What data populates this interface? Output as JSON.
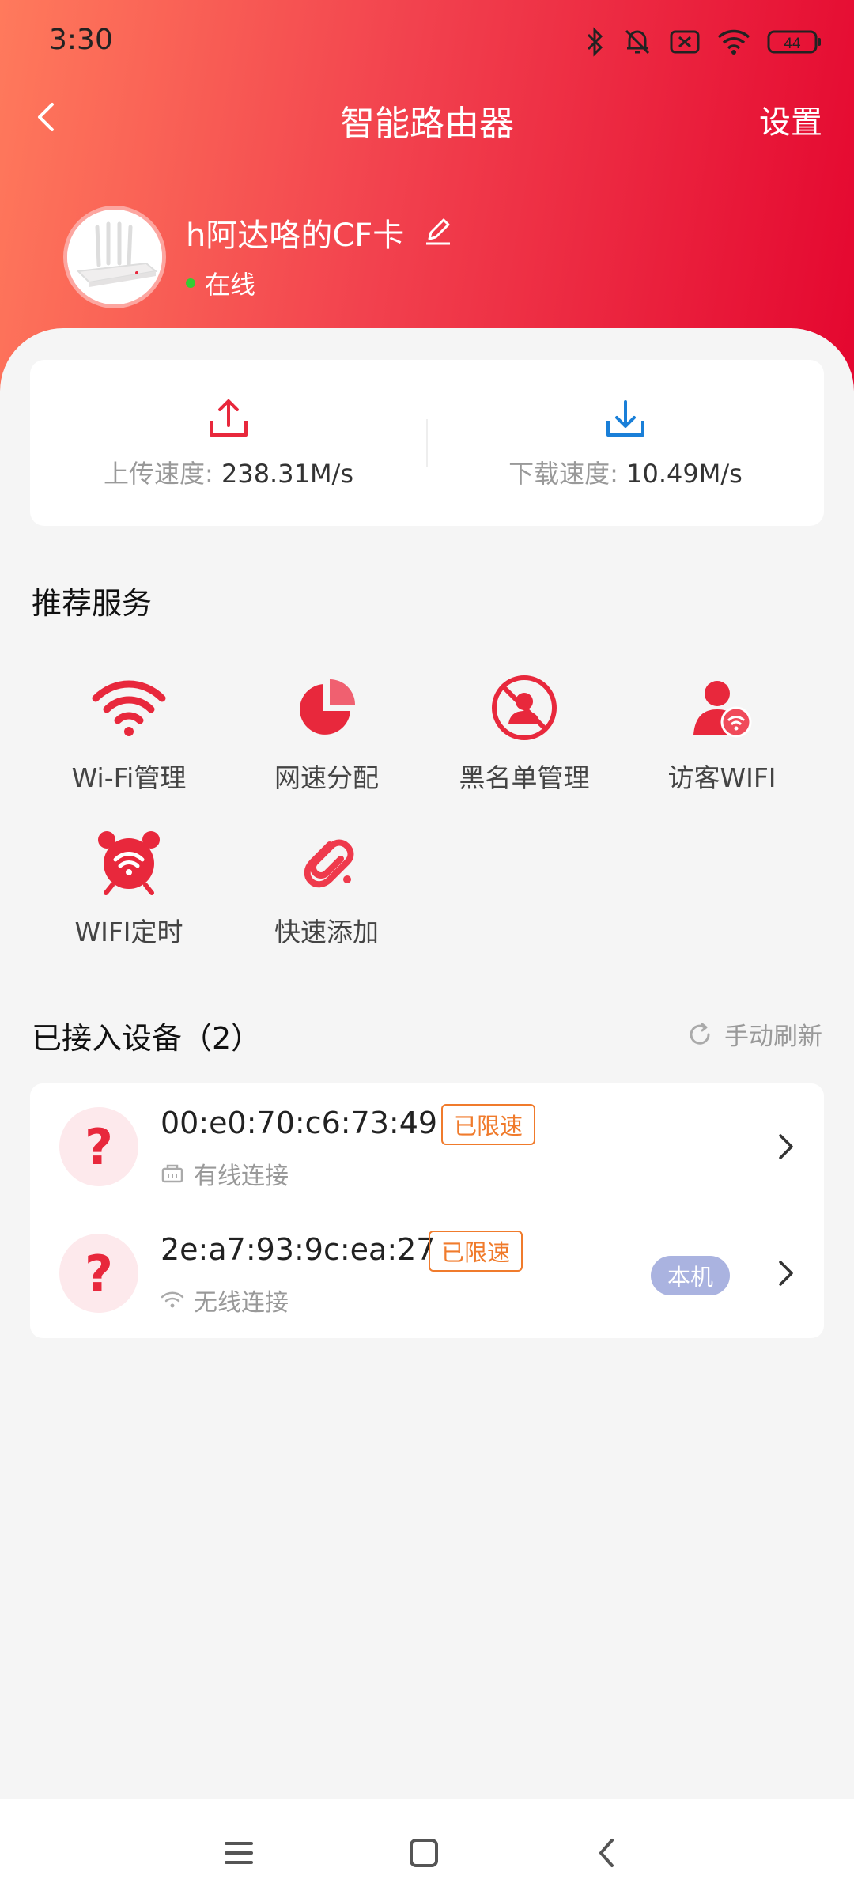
{
  "status_bar": {
    "time": "3:30",
    "battery": "44",
    "icons": [
      "bluetooth-icon",
      "mute-bell-icon",
      "sim-off-icon",
      "wifi-icon",
      "battery-icon"
    ]
  },
  "header": {
    "title": "智能路由器",
    "settings_label": "设置",
    "back_icon": "chevron-left-icon"
  },
  "router": {
    "name": "h阿达咯的CF卡",
    "status": "在线",
    "status_color": "#33cc33"
  },
  "speed": {
    "upload_label": "上传速度:",
    "upload_value": "238.31M/s",
    "download_label": "下载速度:",
    "download_value": "10.49M/s"
  },
  "services": {
    "title": "推荐服务",
    "items": [
      {
        "label": "Wi-Fi管理",
        "icon": "wifi-icon"
      },
      {
        "label": "网速分配",
        "icon": "pie-chart-icon"
      },
      {
        "label": "黑名单管理",
        "icon": "block-user-icon"
      },
      {
        "label": "访客WIFI",
        "icon": "guest-wifi-icon"
      },
      {
        "label": "WIFI定时",
        "icon": "alarm-wifi-icon"
      },
      {
        "label": "快速添加",
        "icon": "link-add-icon"
      }
    ]
  },
  "devices": {
    "title": "已接入设备（2）",
    "refresh_label": "手动刷新",
    "list": [
      {
        "mac": "00:e0:70:c6:73:49",
        "badge": "已限速",
        "connection": "有线连接",
        "self_tag": ""
      },
      {
        "mac": "2e:a7:93:9c:ea:27",
        "badge": "已限速",
        "connection": "无线连接",
        "self_tag": "本机"
      }
    ]
  },
  "theme": {
    "accent": "#e8283c",
    "badge_color": "#f07b2c"
  }
}
